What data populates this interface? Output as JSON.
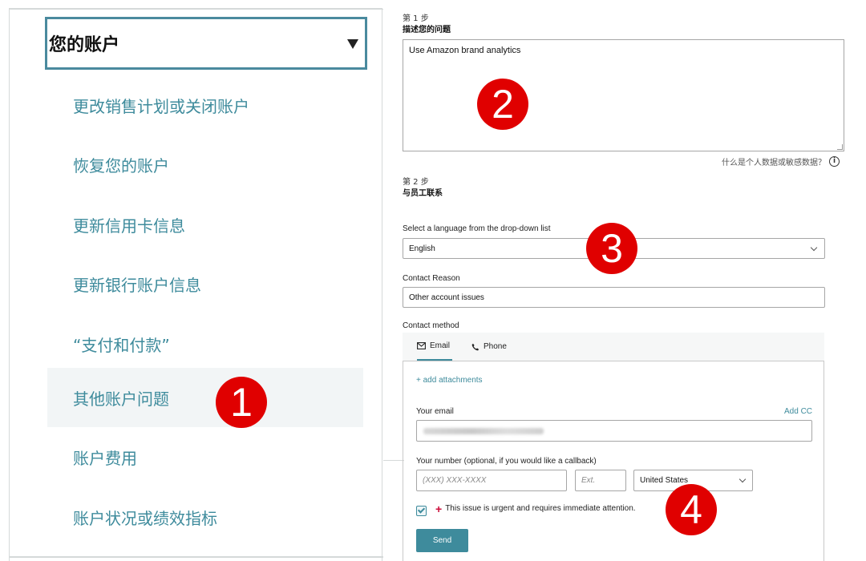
{
  "left": {
    "header_title": "您的账户",
    "items": [
      "更改销售计划或关闭账户",
      "恢复您的账户",
      "更新信用卡信息",
      "更新银行账户信息",
      "“支付和付款”",
      "其他账户问题",
      "账户费用",
      "账户状况或绩效指标"
    ],
    "active_index": 5
  },
  "step1": {
    "label": "第 1 步",
    "title": "描述您的问题",
    "description_value": "Use Amazon brand analytics",
    "privacy_text": "什么是个人数据或敏感数据？"
  },
  "step2": {
    "label": "第 2 步",
    "title": "与员工联系"
  },
  "language": {
    "label": "Select a language from the drop-down list",
    "value": "English"
  },
  "reason": {
    "label": "Contact Reason",
    "value": "Other account issues"
  },
  "contact": {
    "label": "Contact method",
    "tabs": [
      "Email",
      "Phone"
    ],
    "active_tab": "Email",
    "add_attachments": "+ add attachments",
    "email_label": "Your email",
    "add_cc": "Add CC",
    "number_label": "Your number (optional, if you would like a callback)",
    "number_placeholder": "(XXX) XXX-XXXX",
    "ext_placeholder": "Ext.",
    "country": "United States",
    "urgent_text": "This issue is urgent and requires immediate attention.",
    "urgent_checked": true,
    "send_label": "Send"
  },
  "badges": [
    "1",
    "2",
    "3",
    "4"
  ],
  "colors": {
    "accent": "#3e8b9c",
    "badge": "#e00000",
    "required": "#cc0c39"
  }
}
